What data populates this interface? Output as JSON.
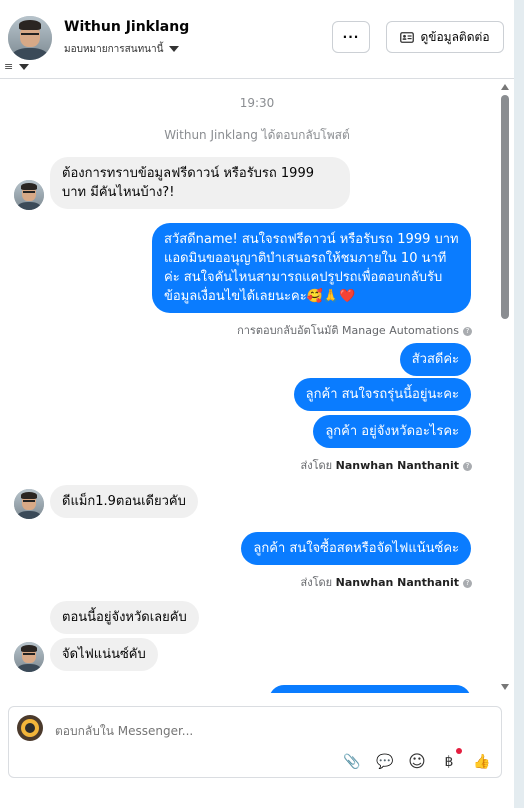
{
  "header": {
    "contact_name": "Withun Jinklang",
    "assign_label": "มอบหมายการสนทนานี้",
    "filter_icon": "≡",
    "more_label": "···",
    "contact_button_label": "ดูข้อมูลติดต่อ"
  },
  "conversation": {
    "time": "19:30",
    "reply_notice": "Withun Jinklang ได้ตอบกลับโพสต์",
    "messages": [
      {
        "text": "ต้องการทราบข้อมูลฟรีดาวน์ หรือรับรถ 1999 บาท มีคันไหนบ้าง?!"
      },
      {
        "text": "สวัสดีname! สนใจรถฟรีดาวน์ หรือรับรถ 1999 บาท แอดมินขออนุญาติบำเสนอรถให้ชมภายใน 10 นาทีค่ะ สนใจคันไหนสามารถแคปรูปรถเพื่อตอบกลับรับข้อมูลเงื่อนไขได้เลยนะคะ🥰🙏❤️"
      },
      {
        "text": "สัวสดีค่ะ"
      },
      {
        "text": "ลูกค้า  สนใจรถรุ่นนี้อยู่นะคะ"
      },
      {
        "text": "ลูกค้า  อยู่จังหวัดอะไรคะ"
      },
      {
        "text": "ดีแม็ก1.9ตอนเดียวคับ"
      },
      {
        "text": "ลูกค้า  สนใจซื้อสดหรือจัดไฟแน้นซ์คะ"
      },
      {
        "text": "ตอนนี้อยู่จังหวัดเลยคับ"
      },
      {
        "text": "จัดไฟแน่นซ์คับ"
      }
    ],
    "automation_note": "การตอบกลับอัตโนมัติ Manage Automations",
    "sent_by_prefix": "ส่งโดย",
    "sent_by_name": "Nanwhan Nanthanit"
  },
  "composer": {
    "placeholder": "ตอบกลับใน Messenger..."
  },
  "icons": {
    "attach": "📎",
    "saved_reply": "💬",
    "emoji": "☺",
    "payment": "฿",
    "like": "👍"
  },
  "colors": {
    "outgoing_bubble": "#0a7cff",
    "incoming_bubble": "#f0f0f0",
    "notification_dot": "#e41e3f"
  }
}
